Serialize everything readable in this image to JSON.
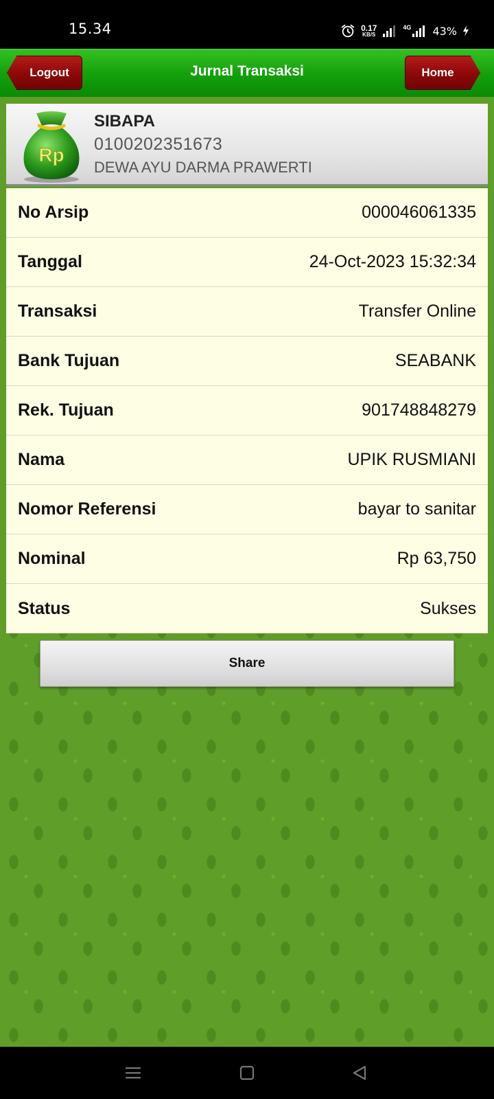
{
  "status_bar": {
    "time": "15.34",
    "net_speed_value": "0.17",
    "net_speed_unit": "KB/S",
    "network_type": "4G",
    "battery": "43%"
  },
  "header": {
    "title": "Jurnal Transaksi",
    "logout_label": "Logout",
    "home_label": "Home"
  },
  "account": {
    "app_name": "SIBAPA",
    "account_number": "0100202351673",
    "holder_name": "DEWA AYU DARMA PRAWERTI",
    "bag_symbol": "Rp"
  },
  "details": [
    {
      "label": "No Arsip",
      "value": "000046061335"
    },
    {
      "label": "Tanggal",
      "value": "24-Oct-2023 15:32:34"
    },
    {
      "label": "Transaksi",
      "value": "Transfer Online"
    },
    {
      "label": "Bank Tujuan",
      "value": "SEABANK"
    },
    {
      "label": "Rek. Tujuan",
      "value": "901748848279"
    },
    {
      "label": "Nama",
      "value": "UPIK RUSMIANI"
    },
    {
      "label": "Nomor Referensi",
      "value": "bayar to sanitar"
    },
    {
      "label": "Nominal",
      "value": "Rp 63,750"
    },
    {
      "label": "Status",
      "value": "Sukses"
    }
  ],
  "share_label": "Share",
  "colors": {
    "header_green": "#14a10c",
    "button_red": "#8c0808",
    "table_bg": "#fefee4",
    "pattern_green": "#5f9e28"
  }
}
